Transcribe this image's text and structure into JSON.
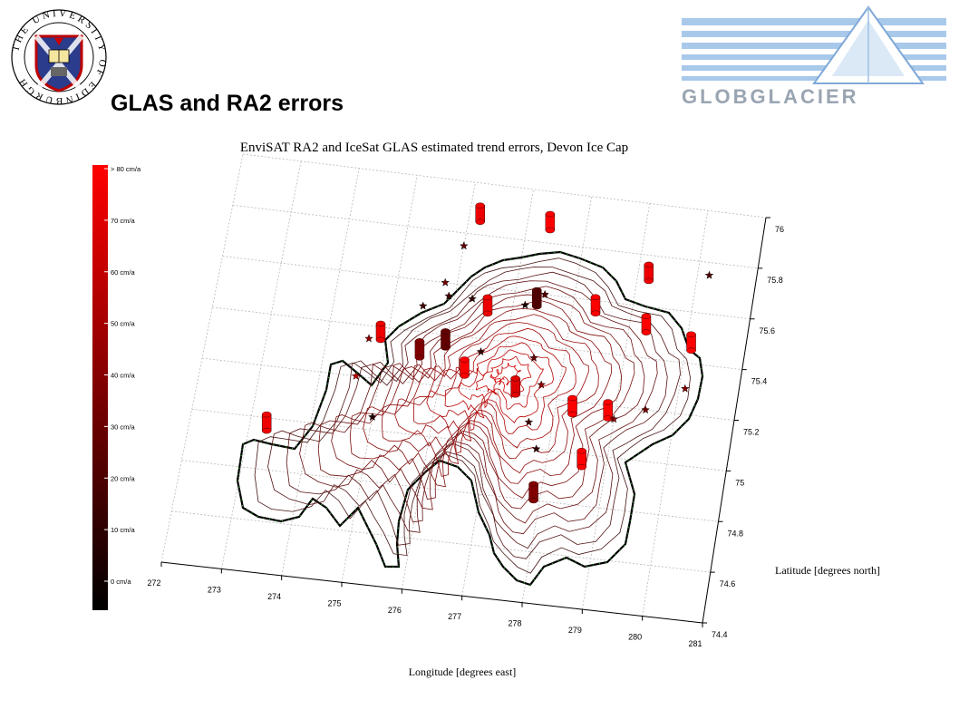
{
  "header": {
    "title": "GLAS and RA2 errors",
    "university_logo": {
      "ring_text": "THE UNIVERSITY OF EDINBURGH",
      "icon": "university-crest-icon"
    },
    "partner_logo": {
      "text": "GLOBGLACIER",
      "icon": "globglacier-triangle-icon"
    }
  },
  "chart_data": {
    "type": "3d-surface-contour",
    "title": "EnviSAT RA2 and IceSat GLAS estimated trend errors, Devon Ice Cap",
    "xlabel": "Longitude [degrees east]",
    "ylabel": "Latitude [degrees north]",
    "x_ticks": [
      "272",
      "273",
      "274",
      "275",
      "276",
      "277",
      "278",
      "279",
      "280",
      "281"
    ],
    "y_ticks": [
      "74.4",
      "74.6",
      "74.8",
      "75",
      "75.2",
      "75.4",
      "75.6",
      "75.8",
      "76"
    ],
    "xlim": [
      272,
      281
    ],
    "ylim": [
      74.4,
      76
    ],
    "colorbar": {
      "ticks": [
        "0 cm/a",
        "10 cm/a",
        "20 cm/a",
        "30 cm/a",
        "40 cm/a",
        "50 cm/a",
        "60 cm/a",
        "70 cm/a",
        "> 80 cm/a"
      ],
      "range": [
        0,
        80
      ],
      "colors": [
        "#000000",
        "#ff0000"
      ]
    },
    "series": [
      {
        "name": "RA2",
        "marker": "cylinder",
        "points": [
          {
            "lon": 273.3,
            "lat": 74.95,
            "error": 75
          },
          {
            "lon": 274.9,
            "lat": 75.35,
            "error": 75
          },
          {
            "lon": 275.6,
            "lat": 75.3,
            "error": 40
          },
          {
            "lon": 276.0,
            "lat": 75.35,
            "error": 30
          },
          {
            "lon": 276.4,
            "lat": 75.25,
            "error": 80
          },
          {
            "lon": 276.6,
            "lat": 75.5,
            "error": 75
          },
          {
            "lon": 277.3,
            "lat": 75.2,
            "error": 70
          },
          {
            "lon": 277.4,
            "lat": 75.55,
            "error": 25
          },
          {
            "lon": 277.9,
            "lat": 74.8,
            "error": 40
          },
          {
            "lon": 276.2,
            "lat": 75.85,
            "error": 75
          },
          {
            "lon": 277.4,
            "lat": 75.85,
            "error": 80
          },
          {
            "lon": 278.4,
            "lat": 75.55,
            "error": 80
          },
          {
            "lon": 278.3,
            "lat": 75.15,
            "error": 80
          },
          {
            "lon": 278.6,
            "lat": 74.95,
            "error": 80
          },
          {
            "lon": 278.9,
            "lat": 75.15,
            "error": 80
          },
          {
            "lon": 279.3,
            "lat": 75.5,
            "error": 80
          },
          {
            "lon": 279.2,
            "lat": 75.7,
            "error": 75
          },
          {
            "lon": 280.1,
            "lat": 75.45,
            "error": 80
          }
        ]
      },
      {
        "name": "GLAS",
        "marker": "star",
        "points": [
          {
            "lon": 274.6,
            "lat": 75.2,
            "error": 60
          },
          {
            "lon": 274.7,
            "lat": 75.35,
            "error": 45
          },
          {
            "lon": 275.0,
            "lat": 75.05,
            "error": 10
          },
          {
            "lon": 275.5,
            "lat": 75.5,
            "error": 20
          },
          {
            "lon": 275.8,
            "lat": 75.6,
            "error": 35
          },
          {
            "lon": 275.9,
            "lat": 75.55,
            "error": 20
          },
          {
            "lon": 276.0,
            "lat": 75.75,
            "error": 30
          },
          {
            "lon": 276.3,
            "lat": 75.55,
            "error": 15
          },
          {
            "lon": 276.6,
            "lat": 75.35,
            "error": 15
          },
          {
            "lon": 277.2,
            "lat": 75.55,
            "error": 10
          },
          {
            "lon": 277.5,
            "lat": 75.6,
            "error": 25
          },
          {
            "lon": 277.5,
            "lat": 75.35,
            "error": 30
          },
          {
            "lon": 277.7,
            "lat": 75.25,
            "error": 45
          },
          {
            "lon": 277.6,
            "lat": 75.1,
            "error": 20
          },
          {
            "lon": 277.8,
            "lat": 75.0,
            "error": 15
          },
          {
            "lon": 279.0,
            "lat": 75.15,
            "error": 40
          },
          {
            "lon": 279.5,
            "lat": 75.2,
            "error": 35
          },
          {
            "lon": 280.1,
            "lat": 75.3,
            "error": 40
          },
          {
            "lon": 280.2,
            "lat": 75.75,
            "error": 25
          }
        ]
      }
    ],
    "grid": true
  }
}
